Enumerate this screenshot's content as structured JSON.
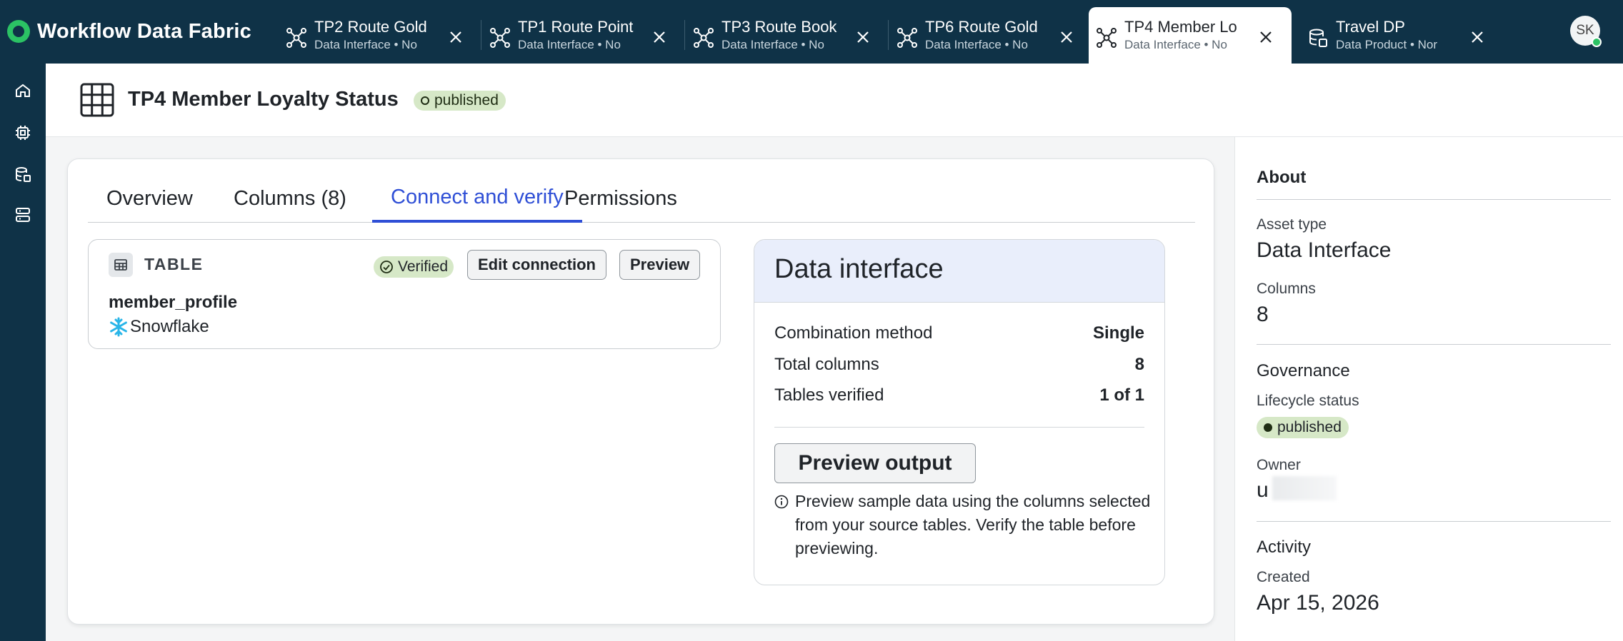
{
  "app": {
    "name": "Workflow Data Fabric",
    "user_initials": "SK"
  },
  "tabs": [
    {
      "title": "TP2 Route Gold",
      "subtitle": "Data Interface • No",
      "icon": "network-icon",
      "active": false
    },
    {
      "title": "TP1 Route Point",
      "subtitle": "Data Interface • No",
      "icon": "network-icon",
      "active": false
    },
    {
      "title": "TP3 Route Book",
      "subtitle": "Data Interface • No",
      "icon": "network-icon",
      "active": false
    },
    {
      "title": "TP6 Route Gold",
      "subtitle": "Data Interface • No",
      "icon": "network-icon",
      "active": false
    },
    {
      "title": "TP4 Member Lo",
      "subtitle": "Data Interface • No",
      "icon": "network-icon",
      "active": true
    },
    {
      "title": "Travel DP",
      "subtitle": "Data Product • Nor",
      "icon": "data-product-icon",
      "active": false
    }
  ],
  "rail": [
    "home-icon",
    "chip-icon",
    "database-icon",
    "server-icon"
  ],
  "header": {
    "title": "TP4 Member Loyalty Status",
    "status": "published"
  },
  "page_tabs": [
    {
      "label": "Overview",
      "active": false
    },
    {
      "label": "Columns (8)",
      "active": false
    },
    {
      "label": "Connect and verify",
      "active": true
    },
    {
      "label": "Permissions",
      "active": false
    }
  ],
  "table_card": {
    "kind": "TABLE",
    "verified": "Verified",
    "edit_button": "Edit connection",
    "preview_button": "Preview",
    "name": "member_profile",
    "source": "Snowflake"
  },
  "data_interface": {
    "title": "Data interface",
    "rows": [
      {
        "label": "Combination method",
        "value": "Single"
      },
      {
        "label": "Total columns",
        "value": "8"
      },
      {
        "label": "Tables verified",
        "value": "1 of 1"
      }
    ],
    "preview_output": "Preview output",
    "info": "Preview sample data using the columns selected from your source tables. Verify the table before previewing."
  },
  "about": {
    "heading": "About",
    "asset_type_label": "Asset type",
    "asset_type": "Data Interface",
    "columns_label": "Columns",
    "columns": "8",
    "governance_heading": "Governance",
    "lifecycle_label": "Lifecycle status",
    "lifecycle": "published",
    "owner_label": "Owner",
    "owner": "u",
    "activity_heading": "Activity",
    "created_label": "Created",
    "created": "Apr 15, 2026"
  },
  "colors": {
    "topbar": "#0f3247",
    "accent": "#2f4fd6",
    "published": "#d6e8c7",
    "brand": "#2bc264"
  }
}
